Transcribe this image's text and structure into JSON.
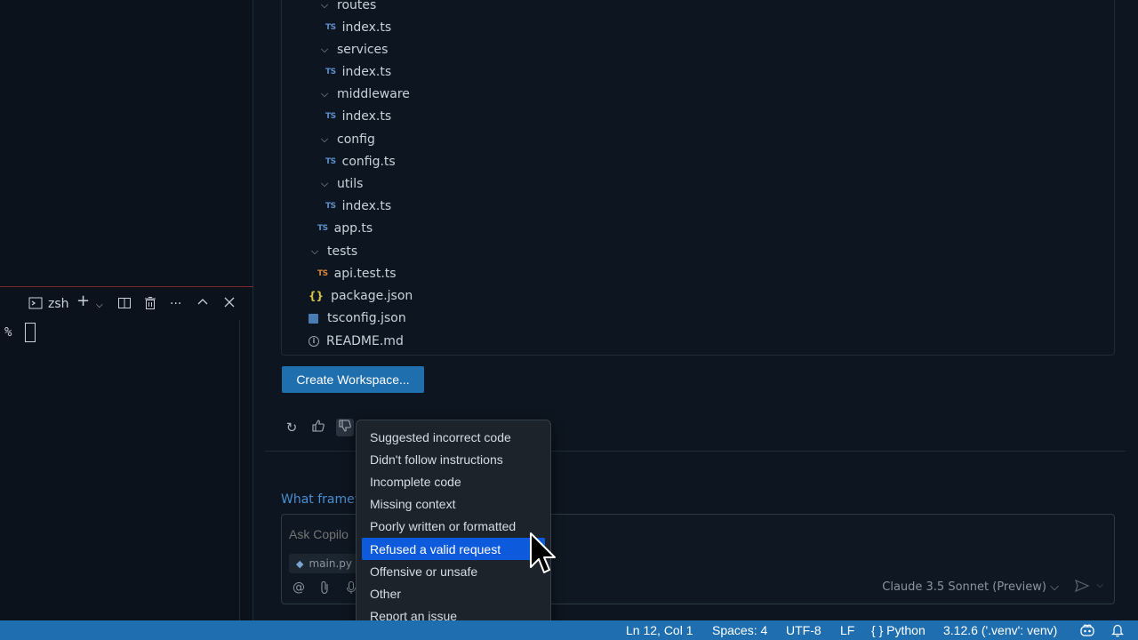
{
  "terminal": {
    "shell_label": "zsh",
    "prompt": "%"
  },
  "tree": [
    {
      "name": "routes",
      "kind": "folder"
    },
    {
      "name": "index.ts",
      "kind": "ts"
    },
    {
      "name": "services",
      "kind": "folder"
    },
    {
      "name": "index.ts",
      "kind": "ts"
    },
    {
      "name": "middleware",
      "kind": "folder"
    },
    {
      "name": "index.ts",
      "kind": "ts"
    },
    {
      "name": "config",
      "kind": "folder"
    },
    {
      "name": "config.ts",
      "kind": "ts"
    },
    {
      "name": "utils",
      "kind": "folder"
    },
    {
      "name": "index.ts",
      "kind": "ts"
    },
    {
      "name": "app.ts",
      "kind": "ts"
    },
    {
      "name": "tests",
      "kind": "folder"
    },
    {
      "name": "api.test.ts",
      "kind": "ts-test"
    },
    {
      "name": "package.json",
      "kind": "json"
    },
    {
      "name": "tsconfig.json",
      "kind": "config"
    },
    {
      "name": "README.md",
      "kind": "info"
    }
  ],
  "create_workspace_label": "Create Workspace...",
  "followup_text": "What framew",
  "chat_input": {
    "placeholder": "Ask Copilo",
    "file_chip": "main.py",
    "model": "Claude 3.5 Sonnet (Preview)"
  },
  "feedback_menu": {
    "items": [
      "Suggested incorrect code",
      "Didn't follow instructions",
      "Incomplete code",
      "Missing context",
      "Poorly written or formatted",
      "Refused a valid request",
      "Offensive or unsafe",
      "Other",
      "Report an issue"
    ],
    "highlighted": "Refused a valid request"
  },
  "status_bar": {
    "position": "Ln 12, Col 1",
    "spaces": "Spaces: 4",
    "encoding": "UTF-8",
    "eol": "LF",
    "language": "Python",
    "interpreter": "3.12.6 ('.venv': venv)"
  },
  "icons": {
    "ts": "TS",
    "json": "{}",
    "info": "i"
  },
  "colors": {
    "accent": "#1f6fb0",
    "menu_highlight": "#0d5bdc",
    "ts_icon": "#5b8fc9",
    "test_icon": "#d9823b"
  }
}
